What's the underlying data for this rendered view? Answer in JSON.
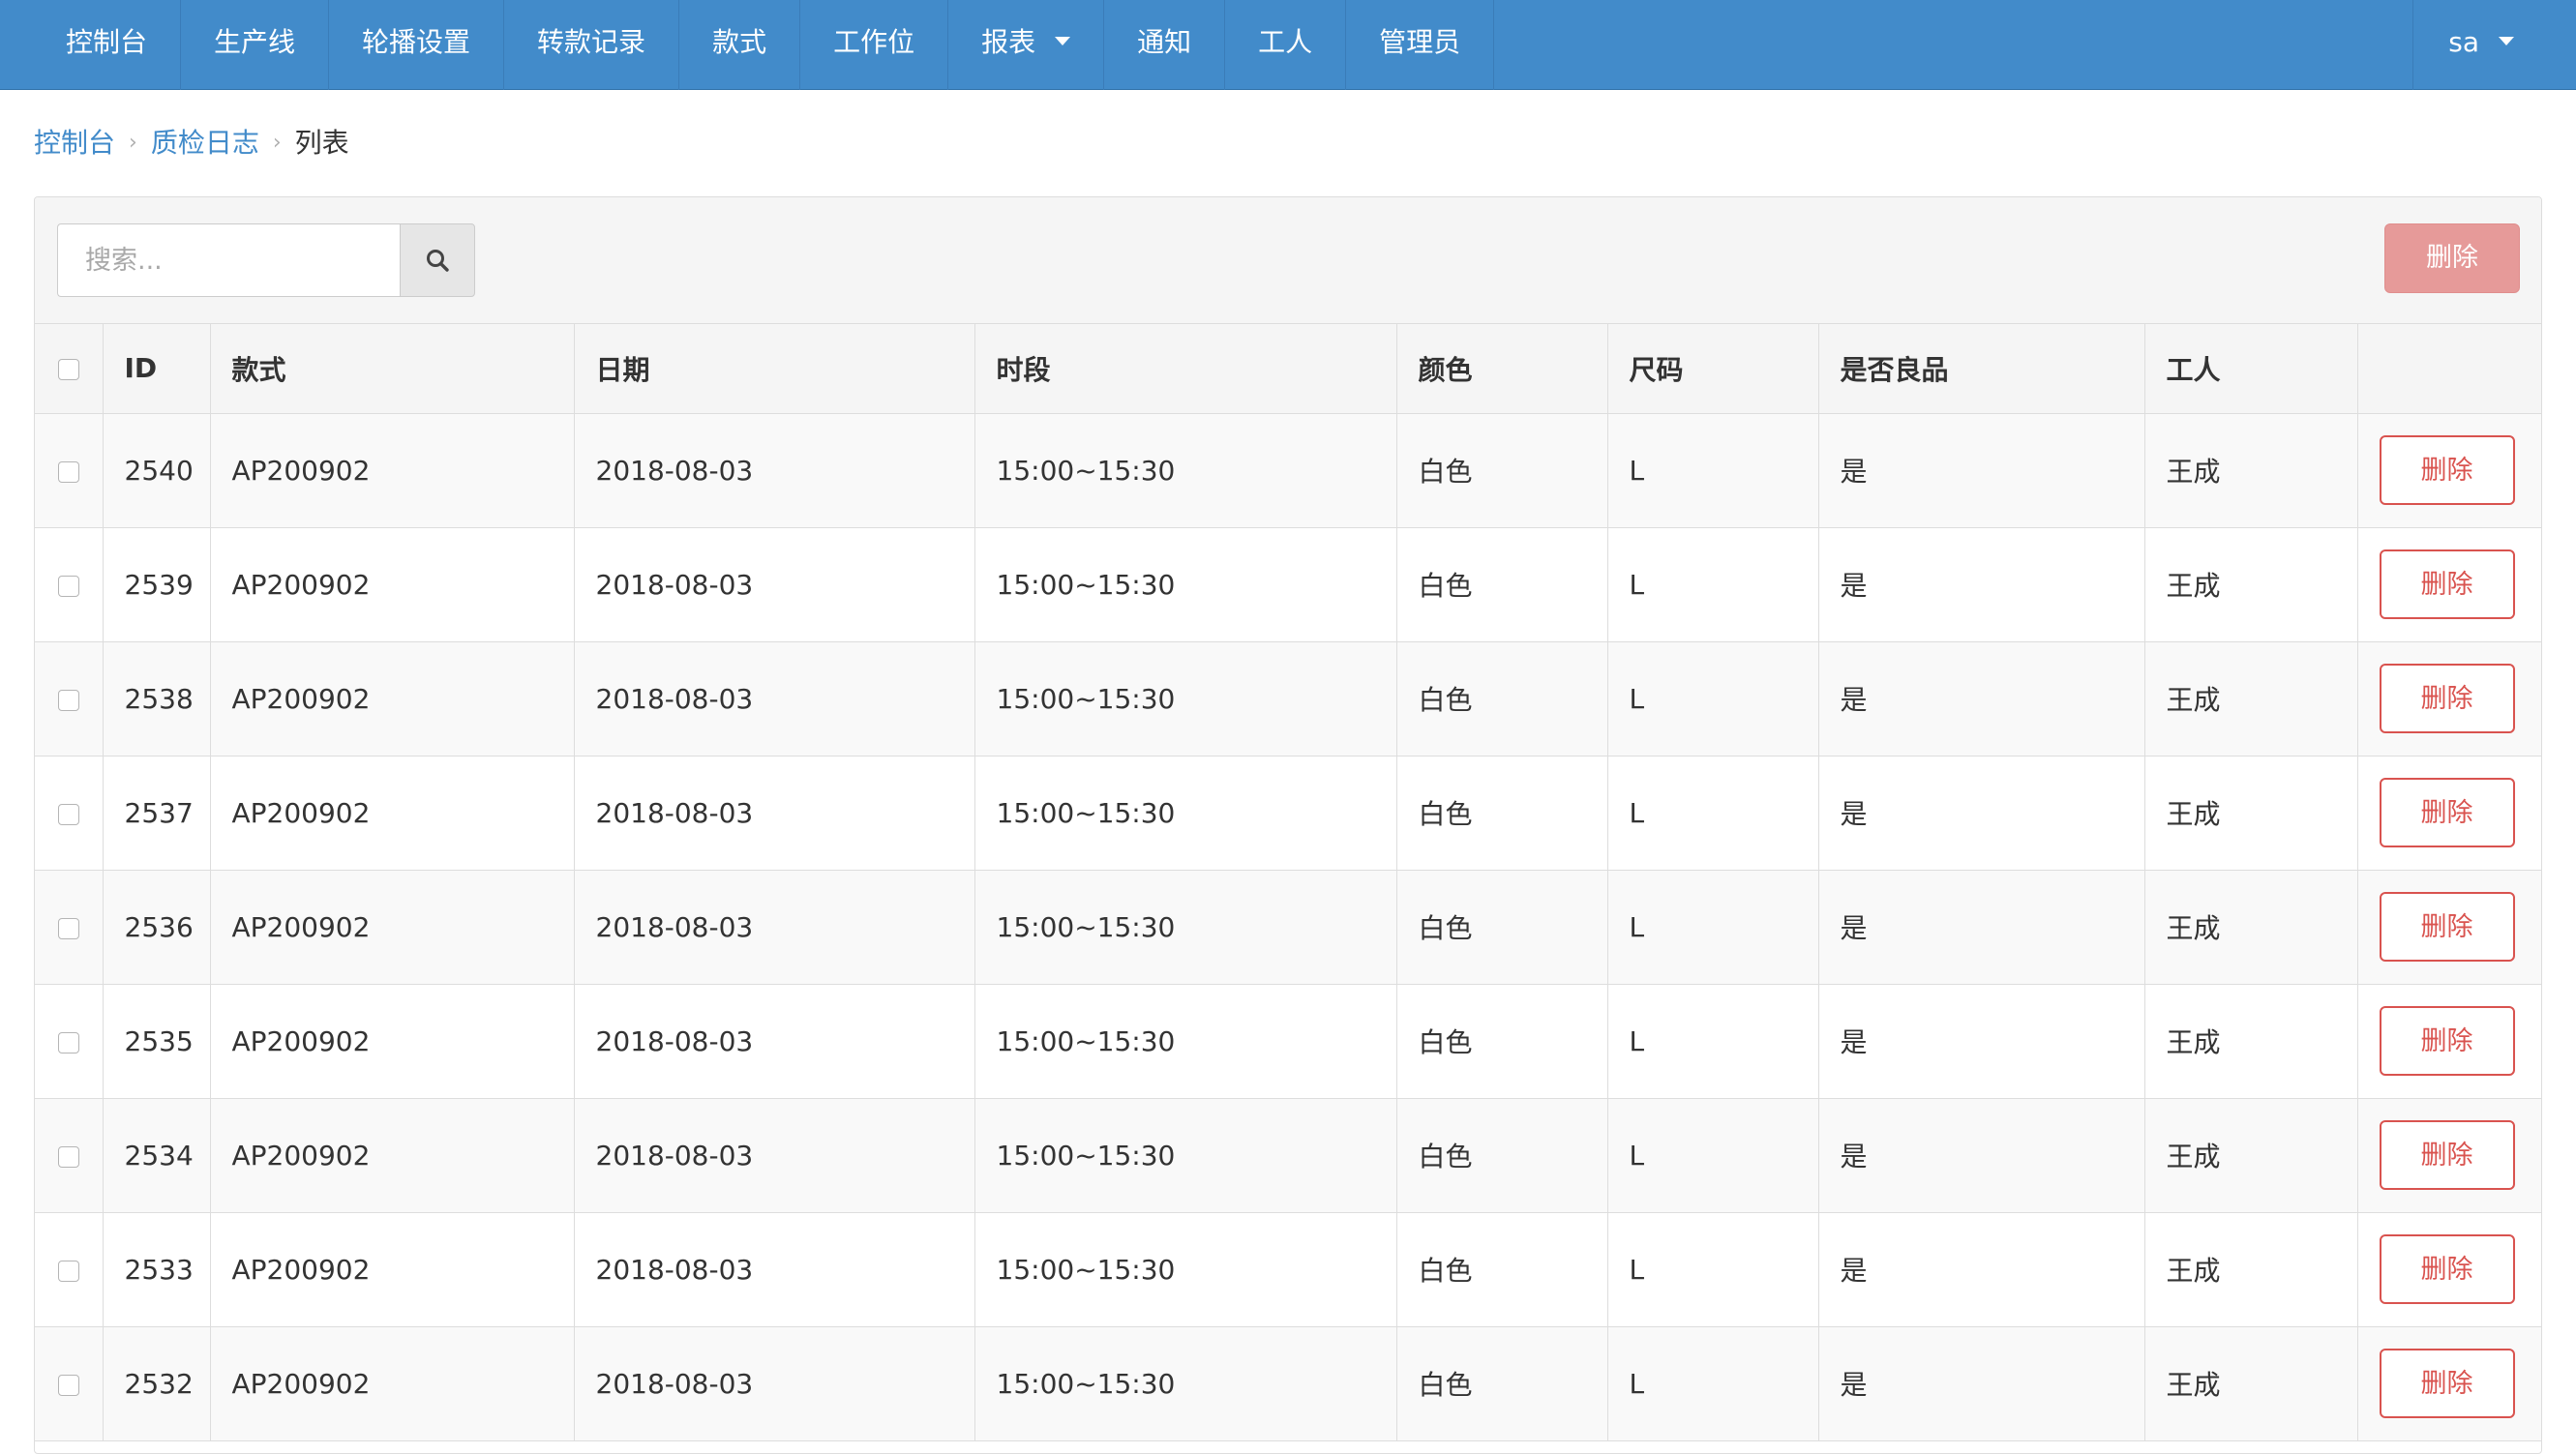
{
  "nav": {
    "items": [
      {
        "label": "控制台"
      },
      {
        "label": "生产线"
      },
      {
        "label": "轮播设置"
      },
      {
        "label": "转款记录"
      },
      {
        "label": "款式"
      },
      {
        "label": "工作位"
      },
      {
        "label": "报表",
        "dropdown": true
      },
      {
        "label": "通知"
      },
      {
        "label": "工人"
      },
      {
        "label": "管理员"
      }
    ],
    "user": "sa"
  },
  "breadcrumb": {
    "items": [
      "控制台",
      "质检日志"
    ],
    "current": "列表"
  },
  "toolbar": {
    "search_placeholder": "搜索...",
    "search_value": "",
    "delete_label": "删除"
  },
  "table": {
    "columns": [
      "ID",
      "款式",
      "日期",
      "时段",
      "颜色",
      "尺码",
      "是否良品",
      "工人"
    ],
    "row_action_label": "删除",
    "rows": [
      {
        "id": "2540",
        "style": "AP200902",
        "date": "2018-08-03",
        "period": "15:00~15:30",
        "color": "白色",
        "size": "L",
        "good": "是",
        "worker": "王成"
      },
      {
        "id": "2539",
        "style": "AP200902",
        "date": "2018-08-03",
        "period": "15:00~15:30",
        "color": "白色",
        "size": "L",
        "good": "是",
        "worker": "王成"
      },
      {
        "id": "2538",
        "style": "AP200902",
        "date": "2018-08-03",
        "period": "15:00~15:30",
        "color": "白色",
        "size": "L",
        "good": "是",
        "worker": "王成"
      },
      {
        "id": "2537",
        "style": "AP200902",
        "date": "2018-08-03",
        "period": "15:00~15:30",
        "color": "白色",
        "size": "L",
        "good": "是",
        "worker": "王成"
      },
      {
        "id": "2536",
        "style": "AP200902",
        "date": "2018-08-03",
        "period": "15:00~15:30",
        "color": "白色",
        "size": "L",
        "good": "是",
        "worker": "王成"
      },
      {
        "id": "2535",
        "style": "AP200902",
        "date": "2018-08-03",
        "period": "15:00~15:30",
        "color": "白色",
        "size": "L",
        "good": "是",
        "worker": "王成"
      },
      {
        "id": "2534",
        "style": "AP200902",
        "date": "2018-08-03",
        "period": "15:00~15:30",
        "color": "白色",
        "size": "L",
        "good": "是",
        "worker": "王成"
      },
      {
        "id": "2533",
        "style": "AP200902",
        "date": "2018-08-03",
        "period": "15:00~15:30",
        "color": "白色",
        "size": "L",
        "good": "是",
        "worker": "王成"
      },
      {
        "id": "2532",
        "style": "AP200902",
        "date": "2018-08-03",
        "period": "15:00~15:30",
        "color": "白色",
        "size": "L",
        "good": "是",
        "worker": "王成"
      }
    ]
  },
  "colors": {
    "navbar": "#428bca",
    "link": "#428bca",
    "danger": "#d9534f",
    "danger_disabled": "#e69a99"
  },
  "icons": {
    "search": "search-icon",
    "dropdown": "caret-down-icon"
  }
}
